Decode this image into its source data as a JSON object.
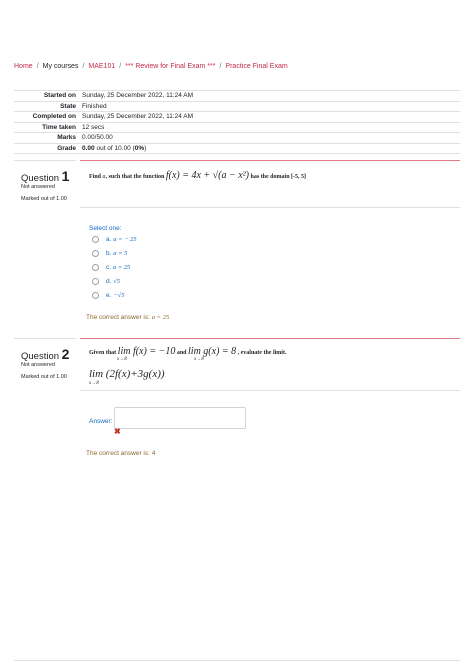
{
  "breadcrumb": {
    "home": "Home",
    "my_courses": "My courses",
    "course": "MAE101",
    "section": "*** Review for Final Exam ***",
    "page": "Practice Final Exam",
    "separator": "/"
  },
  "summary": {
    "started_label": "Started on",
    "started_value": "Sunday, 25 December 2022, 11:24 AM",
    "state_label": "State",
    "state_value": "Finished",
    "completed_label": "Completed on",
    "completed_value": "Sunday, 25 December 2022, 11:24 AM",
    "time_label": "Time taken",
    "time_value": "12 secs",
    "marks_label": "Marks",
    "marks_value": "0.00/50.00",
    "grade_label": "Grade",
    "grade_bold": "0.00",
    "grade_mid": " out of 10.00 (",
    "grade_pct": "0%",
    "grade_end": ")"
  },
  "q1": {
    "label": "Question",
    "number": "1",
    "status": "Not answered",
    "marked": "Marked out of 1.00",
    "text_prefix": "Find ",
    "text_var": "a",
    "text_mid": ", such that the function ",
    "function": "f(x) = 4x + √(a − x²)",
    "text_suffix": " has the domain [-5, 5]",
    "select_prompt": "Select one:",
    "options": [
      {
        "letter": "a.",
        "value": "a = − 25"
      },
      {
        "letter": "b.",
        "value": "a = 5"
      },
      {
        "letter": "c.",
        "value": "a = 25"
      },
      {
        "letter": "d.",
        "value": "√5"
      },
      {
        "letter": "e.",
        "value": "−√5"
      }
    ],
    "correct_prefix": "The correct answer is: ",
    "correct_value": "a = 25"
  },
  "q2": {
    "label": "Question",
    "number": "2",
    "status": "Not answered",
    "marked": "Marked out of 1.00",
    "given": "Given that ",
    "limit1": "lim f(x) = −10",
    "and": " and ",
    "limit2": "lim g(x) = 8",
    "evaluate": " , evaluate the limit.",
    "limit_sub": "x→8",
    "expression": "lim (2f(x)+3g(x))",
    "answer_label": "Answer:",
    "answer_value": "",
    "correct_prefix": "The correct answer is: ",
    "correct_value": "4"
  },
  "colors": {
    "link": "#c52a4a",
    "prompt": "#0f6cbf",
    "feedback": "#8e662e",
    "incorrect": "#ca3120",
    "question_rule": "#e07b8a"
  },
  "icons": {
    "incorrect": "cross-icon",
    "radio": "radio-button"
  }
}
